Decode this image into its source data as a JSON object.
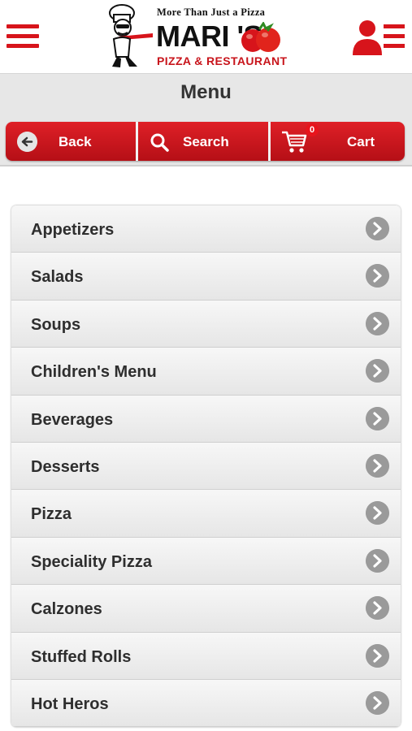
{
  "header": {
    "tagline": "More Than Just a Pizza",
    "brand": "MARI   'S",
    "subtitle": "PIZZA & RESTAURANT"
  },
  "page": {
    "title": "Menu"
  },
  "nav": {
    "back_label": "Back",
    "search_label": "Search",
    "cart_label": "Cart",
    "cart_count": "0"
  },
  "menu": {
    "items": [
      {
        "label": "Appetizers"
      },
      {
        "label": "Salads"
      },
      {
        "label": "Soups"
      },
      {
        "label": "Children's Menu"
      },
      {
        "label": "Beverages"
      },
      {
        "label": "Desserts"
      },
      {
        "label": "Pizza"
      },
      {
        "label": "Speciality Pizza"
      },
      {
        "label": "Calzones"
      },
      {
        "label": "Stuffed Rolls"
      },
      {
        "label": "Hot Heros"
      }
    ]
  },
  "colors": {
    "accent": "#d7141b",
    "title_bar": "#e7e7e7",
    "arrow": "#9a9a9a"
  },
  "icons": [
    "menu-icon",
    "chef-mascot",
    "tomato-icon",
    "account-icon",
    "back-arrow-icon",
    "search-icon",
    "cart-icon",
    "chevron-right-icon"
  ]
}
